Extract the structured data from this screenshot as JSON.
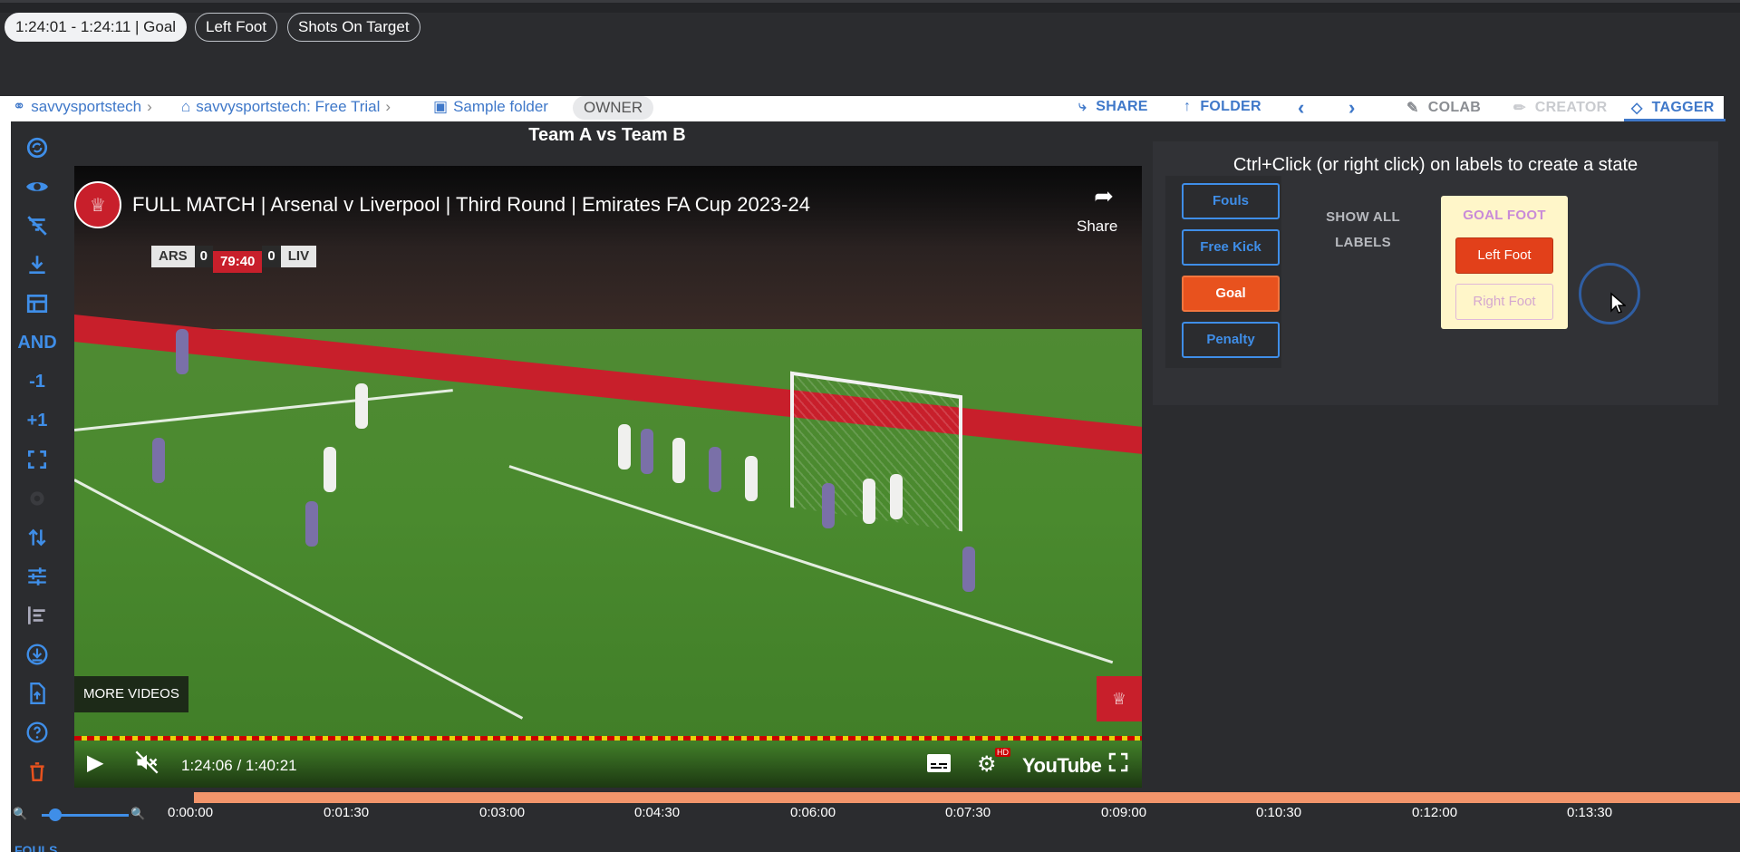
{
  "chips": [
    {
      "label": "1:24:01 - 1:24:11 | Goal",
      "active": true
    },
    {
      "label": "Left Foot",
      "active": false
    },
    {
      "label": "Shots On Target",
      "active": false
    }
  ],
  "breadcrumb": {
    "user": "savvysportstech",
    "workspace": "savvysportstech: Free Trial",
    "folder": "Sample folder",
    "role": "OWNER"
  },
  "toolbar": {
    "share": "SHARE",
    "folder": "FOLDER",
    "colab": "COLAB",
    "creator": "CREATOR",
    "tagger": "TAGGER"
  },
  "sidebar": {
    "and_label": "AND",
    "minus_label": "-1",
    "plus_label": "+1"
  },
  "video": {
    "page_title": "Team A vs Team B",
    "heading": "FULL MATCH | Arsenal v Liverpool | Third Round | Emirates FA Cup 2023-24",
    "share_label": "Share",
    "score": {
      "home": "ARS",
      "home_score": "0",
      "clock": "79:40",
      "away_score": "0",
      "away": "LIV"
    },
    "more_videos": "MORE VIDEOS",
    "time": "1:24:06 / 1:40:21",
    "brand": "YouTube",
    "hd_badge": "HD"
  },
  "tagger": {
    "instruction": "Ctrl+Click (or right click) on labels to create a state",
    "labels": [
      {
        "label": "Fouls",
        "on": false
      },
      {
        "label": "Free Kick",
        "on": false
      },
      {
        "label": "Goal",
        "on": true
      },
      {
        "label": "Penalty",
        "on": false
      }
    ],
    "show_all": "SHOW ALL LABELS",
    "state": {
      "title": "GOAL FOOT",
      "options": [
        {
          "label": "Left Foot",
          "on": true
        },
        {
          "label": "Right Foot",
          "on": false
        }
      ]
    }
  },
  "timeline": {
    "ticks": [
      "0:00:00",
      "0:01:30",
      "0:03:00",
      "0:04:30",
      "0:06:00",
      "0:07:30",
      "0:09:00",
      "0:10:30",
      "0:12:00",
      "0:13:30"
    ],
    "row_label": "FOULS"
  },
  "colors": {
    "accent": "#3f8ee8",
    "goal_orange": "#e8521e",
    "state_yellow": "#fff6c9",
    "timeline_bar": "#f2956b"
  }
}
